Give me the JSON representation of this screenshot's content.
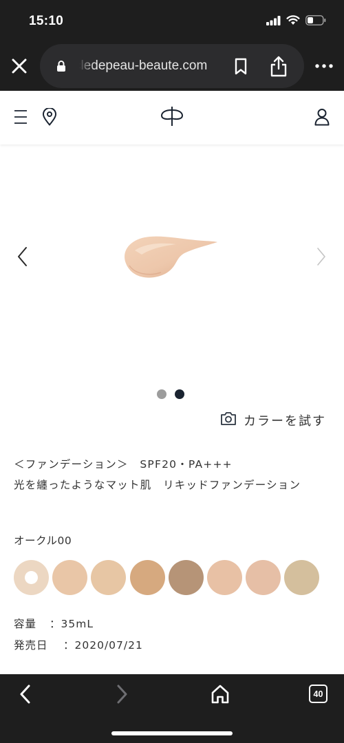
{
  "status_bar": {
    "time": "15:10",
    "icons": [
      "signal-icon",
      "wifi-icon",
      "battery-icon"
    ]
  },
  "browser": {
    "url": "cledepeau-beaute.com",
    "buttons": [
      "close-icon",
      "lock-icon",
      "bookmark-icon",
      "share-icon",
      "more-icon"
    ]
  },
  "site_header": {
    "icons": [
      "menu-icon",
      "location-pin-icon",
      "brand-logo",
      "user-icon"
    ]
  },
  "carousel": {
    "image": "foundation-swatch-image",
    "slide_count": 2,
    "active_slide": 2
  },
  "try_color": {
    "label": "カラーを試す",
    "icon": "camera-icon"
  },
  "product": {
    "category_line": "＜ファンデーション＞　SPF20・PA+++",
    "name_line": "光を纏ったようなマット肌　リキッドファンデーション",
    "selected_shade": "オークル00"
  },
  "shades": {
    "colors": [
      "#ecd7c2",
      "#e9c6a7",
      "#e7c6a4",
      "#d6a97f",
      "#b69477",
      "#e8c1a5",
      "#e6bfa6",
      "#d4bf9d"
    ],
    "selected_index": 0,
    "selected_color": "#ecd7c2"
  },
  "specs": {
    "volume_label": "容量",
    "volume_value": "：35mL",
    "release_label": "発売日",
    "release_value": "：2020/07/21"
  },
  "toolbar": {
    "tab_count": "40",
    "icons": [
      "back-icon",
      "forward-icon",
      "home-icon",
      "tabs-icon"
    ]
  },
  "colors": {
    "chrome_bg": "#1e1e1e",
    "url_pill_bg": "#2c2c2e",
    "accent_navy": "#1a2330",
    "dot_inactive": "#9c9c9c"
  }
}
